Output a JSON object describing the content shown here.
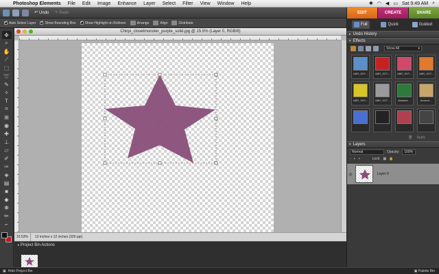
{
  "menubar": {
    "app_name": "Photoshop Elements",
    "items": [
      "File",
      "Edit",
      "Image",
      "Enhance",
      "Layer",
      "Select",
      "Filter",
      "View",
      "Window",
      "Help"
    ],
    "clock": "Sat 9:49 AM"
  },
  "topbar": {
    "undo_label": "Undo",
    "redo_label": "Redo"
  },
  "modes": [
    "EDIT",
    "CREATE",
    "SHARE"
  ],
  "options": {
    "auto_select": "Auto Select Layer",
    "bounding_box": "Show Bounding Box",
    "highlight": "Show Highlight on Rollover",
    "arrange": "Arrange",
    "align": "Align",
    "distribute": "Distribute"
  },
  "document": {
    "title": "Chirpi_closetmonster_purple_solid.jpg @ 15.5% (Layer 0, RGB/8)",
    "zoom": "15.53%",
    "dimensions": "12 inches x 12 inches (300 ppi)",
    "shape_color": "#8a4d7a"
  },
  "project_bin": {
    "label": "Project Bin Actions",
    "hide_label": "Hide Project Bin"
  },
  "panel": {
    "subtabs": [
      "Full",
      "Quick",
      "Guided"
    ],
    "undo_history": "Undo History",
    "effects": "Effects",
    "show_all": "Show All",
    "effects_items": [
      {
        "label": "ABR_SST...",
        "color": "#5b8fc9"
      },
      {
        "label": "ABR_SST...",
        "color": "#c42222"
      },
      {
        "label": "ABR_SST...",
        "color": "#d0486a"
      },
      {
        "label": "ABR_SST...",
        "color": "#e07a2c"
      },
      {
        "label": "ABR_SST...",
        "color": "#d8c427"
      },
      {
        "label": "ABR_SST...",
        "color": "#9a9a9a"
      },
      {
        "label": "Abstract ...",
        "color": "#2e7a3a"
      },
      {
        "label": "Ancient ...",
        "color": "#c9a56a"
      },
      {
        "label": "",
        "color": "#4a6fd0"
      },
      {
        "label": "",
        "color": "#222222"
      },
      {
        "label": "",
        "color": "#b04050"
      },
      {
        "label": "",
        "color": "#444444"
      }
    ],
    "apply": "Apply",
    "layers": "Layers",
    "blend_mode": "Normal",
    "opacity_label": "Opacity:",
    "opacity_value": "100%",
    "lock_label": "Lock:",
    "layer_name": "Layer 0",
    "palette_bin": "Palette Bin"
  }
}
